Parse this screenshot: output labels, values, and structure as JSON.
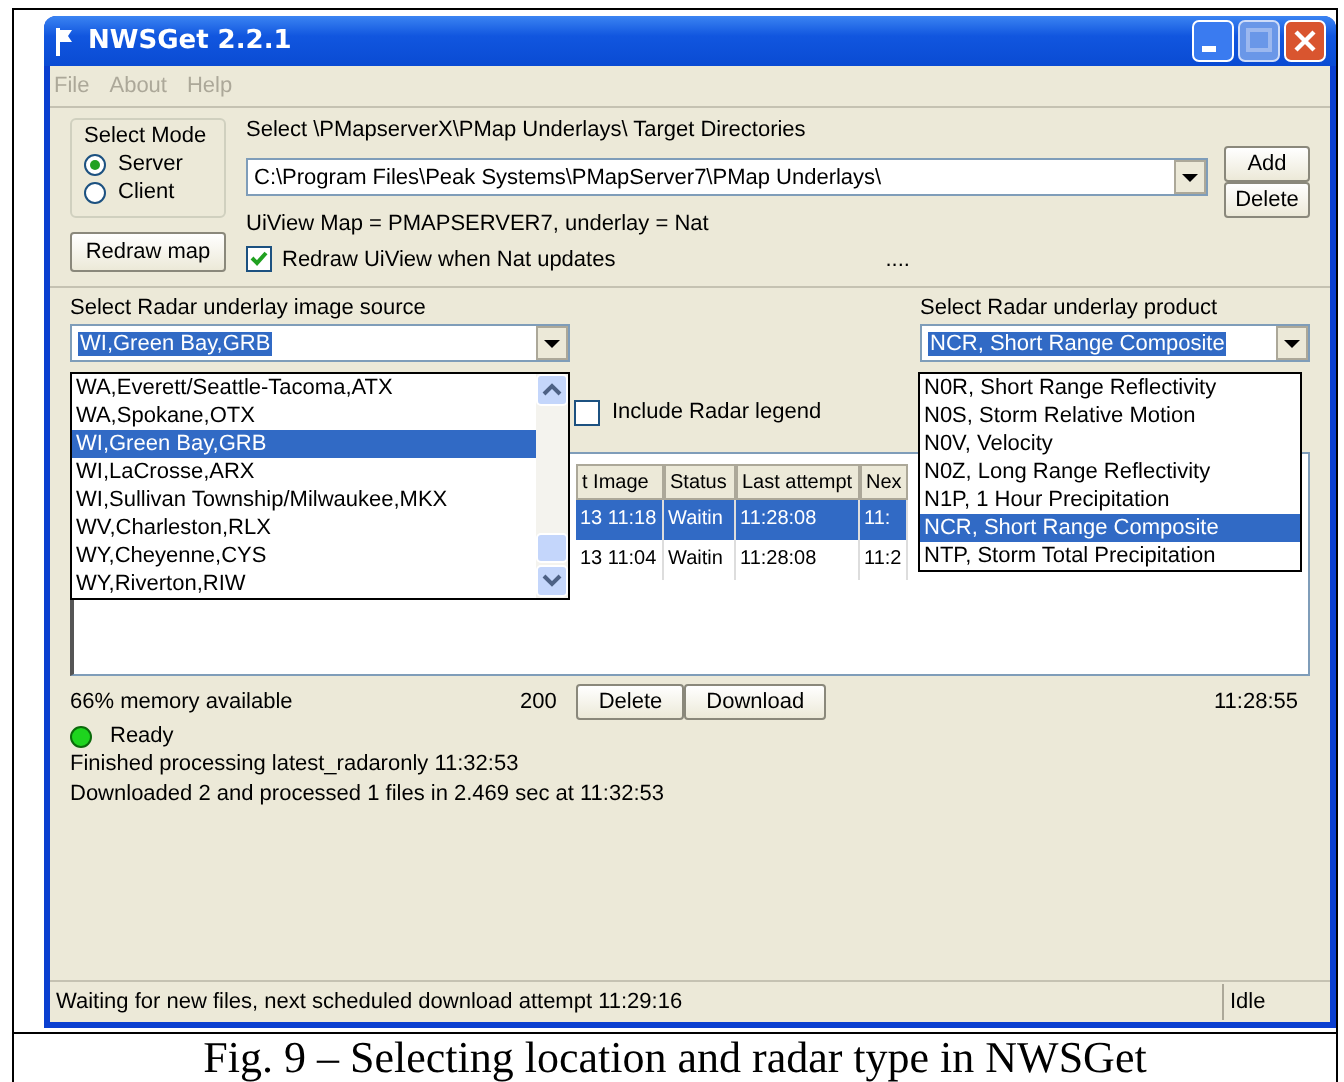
{
  "window": {
    "title": "NWSGet 2.2.1"
  },
  "menu": [
    {
      "label": "File",
      "disabled": true
    },
    {
      "label": "About",
      "disabled": true
    },
    {
      "label": "Help",
      "disabled": true
    }
  ],
  "mode": {
    "title": "Select Mode",
    "options": [
      {
        "label": "Server",
        "selected": true
      },
      {
        "label": "Client",
        "selected": false
      }
    ]
  },
  "target": {
    "label": "Select \\PMapserverX\\PMap Underlays\\ Target Directories",
    "value": "C:\\Program Files\\Peak Systems\\PMapServer7\\PMap Underlays\\",
    "buttons": [
      "Add",
      "Delete"
    ]
  },
  "map_info": "UiView Map = PMAPSERVER7, underlay = Nat",
  "redraw_button": "Redraw map",
  "redraw_checkbox": {
    "label": "Redraw UiView when Nat updates",
    "checked": true
  },
  "progress_dots": "....",
  "source": {
    "label": "Select Radar underlay image source",
    "value": "WI,Green Bay,GRB",
    "options": [
      {
        "label": "WA,Everett/Seattle-Tacoma,ATX",
        "selected": false
      },
      {
        "label": "WA,Spokane,OTX",
        "selected": false
      },
      {
        "label": "WI,Green Bay,GRB",
        "selected": true
      },
      {
        "label": "WI,LaCrosse,ARX",
        "selected": false
      },
      {
        "label": "WI,Sullivan Township/Milwaukee,MKX",
        "selected": false
      },
      {
        "label": "WV,Charleston,RLX",
        "selected": false
      },
      {
        "label": "WY,Cheyenne,CYS",
        "selected": false
      },
      {
        "label": "WY,Riverton,RIW",
        "selected": false
      }
    ]
  },
  "product": {
    "label": "Select Radar underlay product",
    "value": "NCR, Short Range Composite",
    "options": [
      {
        "label": "N0R, Short Range Reflectivity",
        "selected": false
      },
      {
        "label": "N0S, Storm Relative Motion",
        "selected": false
      },
      {
        "label": "N0V, Velocity",
        "selected": false
      },
      {
        "label": "N0Z, Long Range Reflectivity",
        "selected": false
      },
      {
        "label": "N1P, 1 Hour Precipitation",
        "selected": false
      },
      {
        "label": "NCR, Short Range Composite",
        "selected": true
      },
      {
        "label": "NTP, Storm Total Precipitation",
        "selected": false
      }
    ]
  },
  "legend_checkbox": {
    "label": "Include Radar legend",
    "checked": false
  },
  "table": {
    "columns": [
      "t Image",
      "Status",
      "Last attempt",
      "Nex"
    ],
    "rows": [
      {
        "cells": [
          "13 11:18",
          "Waitin",
          "11:28:08",
          "11:"
        ],
        "selected": true
      },
      {
        "cells": [
          "13 11:04",
          "Waitin",
          "11:28:08",
          "11:2"
        ],
        "selected": false
      }
    ]
  },
  "memory": "66% memory available",
  "count": "200",
  "actions": [
    "Delete",
    "Download"
  ],
  "clock": "11:28:55",
  "status": "Ready",
  "log": [
    "Finished processing latest_radaronly 11:32:53",
    "Downloaded 2 and processed 1 files in 2.469 sec at 11:32:53"
  ],
  "status_bar": {
    "message": "Waiting for new files, next scheduled download attempt 11:29:16",
    "state": "Idle"
  },
  "caption": "Fig. 9 – Selecting location and radar type in NWSGet"
}
